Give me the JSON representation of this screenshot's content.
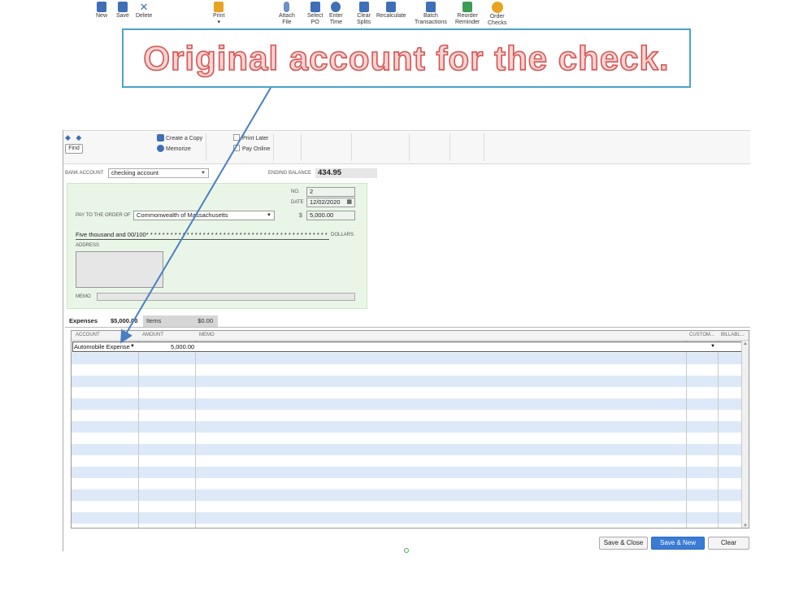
{
  "callout": {
    "text": "Original account for the check."
  },
  "toolbar": {
    "find": "Find",
    "new": "New",
    "save": "Save",
    "delete": "Delete",
    "create_copy": "Create a Copy",
    "memorize": "Memorize",
    "print": "Print",
    "print_later": "Print Later",
    "pay_online": "Pay Online",
    "attach_file_1": "Attach",
    "attach_file_2": "File",
    "select_po_1": "Select",
    "select_po_2": "PO",
    "enter_time_1": "Enter",
    "enter_time_2": "Time",
    "clear_splits_1": "Clear",
    "clear_splits_2": "Splits",
    "recalculate": "Recalculate",
    "batch_1": "Batch",
    "batch_2": "Transactions",
    "reorder_1": "Reorder",
    "reorder_2": "Reminder",
    "order_1": "Order",
    "order_2": "Checks"
  },
  "header": {
    "bank_account_label": "BANK ACCOUNT",
    "bank_account_value": "checking account",
    "ending_balance_label": "ENDING BALANCE",
    "ending_balance_value": "434.95"
  },
  "check": {
    "no_label": "NO.",
    "no_value": "2",
    "date_label": "DATE",
    "date_value": "12/02/2020",
    "pay_to_label": "PAY TO THE ORDER OF",
    "payee": "Commonwealth of Massachusetts",
    "dollar_sign": "$",
    "amount": "5,000.00",
    "amount_words": "Five thousand  and 00/100* * * * * * * * * * * * * * * * * * * * * * * * * * * * * * * * * * * * * * * * * * * * * * * * * * * * * * * * * *",
    "dollars_label": "DOLLARS",
    "address_label": "ADDRESS",
    "memo_label": "MEMO"
  },
  "tabs": {
    "expenses_label": "Expenses",
    "expenses_amount": "$5,000.00",
    "items_label": "Items",
    "items_amount": "$0.00"
  },
  "grid": {
    "columns": [
      "ACCOUNT",
      "AMOUNT",
      "MEMO",
      "CUSTOM...",
      "BILLABL..."
    ],
    "rows": [
      {
        "account": "Automobile Expense",
        "amount": "5,000.00",
        "memo": ""
      }
    ]
  },
  "buttons": {
    "save_close": "Save & Close",
    "save_new": "Save & New",
    "clear": "Clear"
  },
  "colors": {
    "callout_border": "#4aa3c8",
    "callout_text": "#d9534f",
    "arrow": "#4a7fc1",
    "check_bg": "#e9f6e7",
    "row_blue": "#dde9f8",
    "primary_button": "#3a7bd5"
  }
}
